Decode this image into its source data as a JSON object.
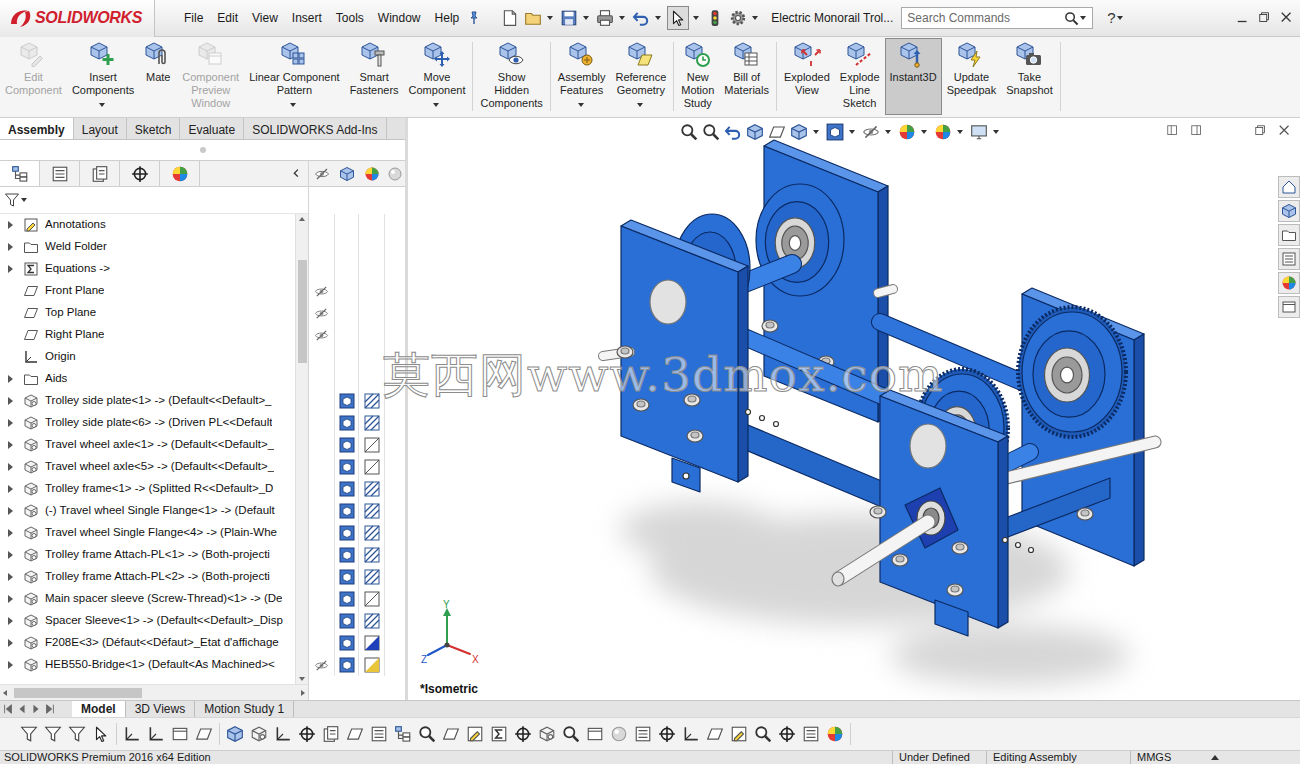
{
  "app": {
    "logo": "SOLIDWORKS",
    "menus": [
      "File",
      "Edit",
      "View",
      "Insert",
      "Tools",
      "Window",
      "Help"
    ],
    "title": "Electric Monorail Trol...",
    "search": {
      "placeholder": "Search Commands"
    },
    "help": "?"
  },
  "ribbon": [
    {
      "label": "Edit\nComponent",
      "disabled": true,
      "selected": false,
      "dropdown": false
    },
    {
      "label": "Insert\nComponents",
      "disabled": false,
      "selected": false,
      "dropdown": true
    },
    {
      "label": "Mate",
      "disabled": false,
      "selected": false,
      "dropdown": false
    },
    {
      "label": "Component\nPreview\nWindow",
      "disabled": true,
      "selected": false,
      "dropdown": false
    },
    {
      "label": "Linear Component\nPattern",
      "disabled": false,
      "selected": false,
      "dropdown": true
    },
    {
      "label": "Smart\nFasteners",
      "disabled": false,
      "selected": false,
      "dropdown": false
    },
    {
      "label": "Move\nComponent",
      "disabled": false,
      "selected": false,
      "dropdown": true
    },
    {
      "label": "Show\nHidden\nComponents",
      "disabled": false,
      "selected": false,
      "dropdown": false
    },
    {
      "label": "Assembly\nFeatures",
      "disabled": false,
      "selected": false,
      "dropdown": true
    },
    {
      "label": "Reference\nGeometry",
      "disabled": false,
      "selected": false,
      "dropdown": true
    },
    {
      "label": "New\nMotion\nStudy",
      "disabled": false,
      "selected": false,
      "dropdown": false
    },
    {
      "label": "Bill of\nMaterials",
      "disabled": false,
      "selected": false,
      "dropdown": false
    },
    {
      "label": "Exploded\nView",
      "disabled": false,
      "selected": false,
      "dropdown": false
    },
    {
      "label": "Explode\nLine\nSketch",
      "disabled": false,
      "selected": false,
      "dropdown": false
    },
    {
      "label": "Instant3D",
      "disabled": false,
      "selected": true,
      "dropdown": false
    },
    {
      "label": "Update\nSpeedpak",
      "disabled": false,
      "selected": false,
      "dropdown": false
    },
    {
      "label": "Take\nSnapshot",
      "disabled": false,
      "selected": false,
      "dropdown": false
    }
  ],
  "tabs": [
    {
      "label": "Assembly",
      "selected": true
    },
    {
      "label": "Layout",
      "selected": false
    },
    {
      "label": "Sketch",
      "selected": false
    },
    {
      "label": "Evaluate",
      "selected": false
    },
    {
      "label": "SOLIDWORKS Add-Ins",
      "selected": false
    }
  ],
  "panel_tabs": [
    {
      "selected": true
    },
    {
      "selected": false
    },
    {
      "selected": false
    },
    {
      "selected": false
    },
    {
      "selected": false
    }
  ],
  "tree": [
    {
      "label": "Annotations",
      "kind": "annotations",
      "expandable": true,
      "hidden": false,
      "display": "none"
    },
    {
      "label": "Weld Folder",
      "kind": "folder",
      "expandable": true,
      "hidden": false,
      "display": "none"
    },
    {
      "label": "Equations ->",
      "kind": "equations",
      "expandable": true,
      "hidden": false,
      "display": "none"
    },
    {
      "label": "Front Plane",
      "kind": "plane",
      "expandable": false,
      "hidden": true,
      "display": "none"
    },
    {
      "label": "Top Plane",
      "kind": "plane",
      "expandable": false,
      "hidden": true,
      "display": "none"
    },
    {
      "label": "Right Plane",
      "kind": "plane",
      "expandable": false,
      "hidden": true,
      "display": "none"
    },
    {
      "label": "Origin",
      "kind": "origin",
      "expandable": false,
      "hidden": false,
      "display": "none"
    },
    {
      "label": "Aids",
      "kind": "folder",
      "expandable": true,
      "hidden": false,
      "display": "none"
    },
    {
      "label": "Trolley side plate<1> -> (Default<<Default>_",
      "kind": "component",
      "expandable": true,
      "hidden": false,
      "display": "hatched"
    },
    {
      "label": "Trolley side plate<6> -> (Driven PL<<Default",
      "kind": "component",
      "expandable": true,
      "hidden": false,
      "display": "hatched"
    },
    {
      "label": "Travel wheel axle<1> -> (Default<<Default>_",
      "kind": "component",
      "expandable": true,
      "hidden": false,
      "display": "plain"
    },
    {
      "label": "Travel wheel axle<5> -> (Default<<Default>_",
      "kind": "component",
      "expandable": true,
      "hidden": false,
      "display": "plain"
    },
    {
      "label": "Trolley frame<1> -> (Splitted R<<Default>_D",
      "kind": "component",
      "expandable": true,
      "hidden": false,
      "display": "hatched"
    },
    {
      "label": "(-) Travel wheel Single Flange<1> -> (Default",
      "kind": "component",
      "expandable": true,
      "hidden": false,
      "display": "hatched"
    },
    {
      "label": "Travel wheel Single Flange<4> -> (Plain-Whe",
      "kind": "component",
      "expandable": true,
      "hidden": false,
      "display": "hatched"
    },
    {
      "label": "Trolley frame Attach-PL<1> -> (Both-projecti",
      "kind": "component",
      "expandable": true,
      "hidden": false,
      "display": "hatched"
    },
    {
      "label": "Trolley frame Attach-PL<2> -> (Both-projecti",
      "kind": "component",
      "expandable": true,
      "hidden": false,
      "display": "hatched"
    },
    {
      "label": "Main spacer sleeve (Screw-Thread)<1> -> (De",
      "kind": "component",
      "expandable": true,
      "hidden": false,
      "display": "plain"
    },
    {
      "label": "Spacer Sleeve<1> -> (Default<<Default>_Disp",
      "kind": "component",
      "expandable": true,
      "hidden": false,
      "display": "hatched"
    },
    {
      "label": "F208E<3> (Défaut<<Défaut>_Etat d'affichage",
      "kind": "component",
      "expandable": true,
      "hidden": false,
      "display": "half"
    },
    {
      "label": "HEB550-Bridge<1> (Default<As Machined><",
      "kind": "component",
      "expandable": true,
      "hidden": true,
      "display": "yellow"
    }
  ],
  "viewport": {
    "view_label": "*Isometric",
    "watermark": "莫西网www.3dmox.com",
    "triad": [
      "X",
      "Y",
      "Z"
    ]
  },
  "bottom_tabs": [
    {
      "label": "Model",
      "selected": true
    },
    {
      "label": "3D Views",
      "selected": false
    },
    {
      "label": "Motion Study 1",
      "selected": false
    }
  ],
  "status_bar": [
    "SOLIDWORKS Premium 2016 x64 Edition",
    "Under Defined",
    "Editing Assembly",
    "MMGS"
  ]
}
